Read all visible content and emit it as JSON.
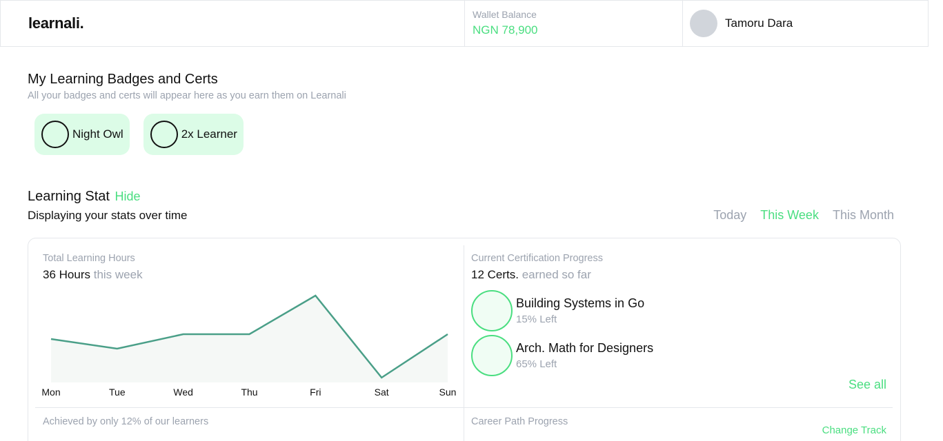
{
  "header": {
    "brand": "learnali.",
    "wallet_label": "Wallet Balance",
    "wallet_amount": "NGN 78,900",
    "user_name": "Tamoru Dara"
  },
  "badges": {
    "title": "My Learning Badges and Certs",
    "subtitle": "All your badges and certs will appear here as you earn them on Learnali",
    "items": [
      {
        "label": "Night Owl"
      },
      {
        "label": "2x Learner"
      }
    ]
  },
  "stats": {
    "title": "Learning Stat",
    "hide_label": "Hide",
    "subtitle": "Displaying your stats over time",
    "periods": [
      {
        "label": "Today",
        "active": false
      },
      {
        "label": "This Week",
        "active": true
      },
      {
        "label": "This Month",
        "active": false
      }
    ]
  },
  "hours_panel": {
    "label": "Total Learning Hours",
    "value": "36 Hours",
    "suffix": "this week"
  },
  "cert_panel": {
    "label": "Current Certification Progress",
    "value": "12 Certs.",
    "suffix": "earned so far",
    "items": [
      {
        "name": "Building Systems in Go",
        "left": "15% Left"
      },
      {
        "name": "Arch. Math for Designers",
        "left": "65% Left"
      }
    ],
    "see_all": "See all"
  },
  "achieved_panel": {
    "label": "Achieved by only 12% of our learners"
  },
  "career_panel": {
    "label": "Career Path Progress",
    "change_track": "Change Track"
  },
  "colors": {
    "accent": "#4ade80",
    "line": "#4a9f88",
    "area": "#f5f8f6",
    "muted": "#9ca3af"
  },
  "chart_data": {
    "type": "area",
    "categories": [
      "Mon",
      "Tue",
      "Wed",
      "Thu",
      "Fri",
      "Sat",
      "Sun"
    ],
    "series": [
      {
        "values": [
          3.5,
          2.5,
          4,
          4,
          8,
          -0.5,
          4
        ]
      }
    ],
    "ylim": [
      -1,
      9
    ],
    "grid": false
  }
}
